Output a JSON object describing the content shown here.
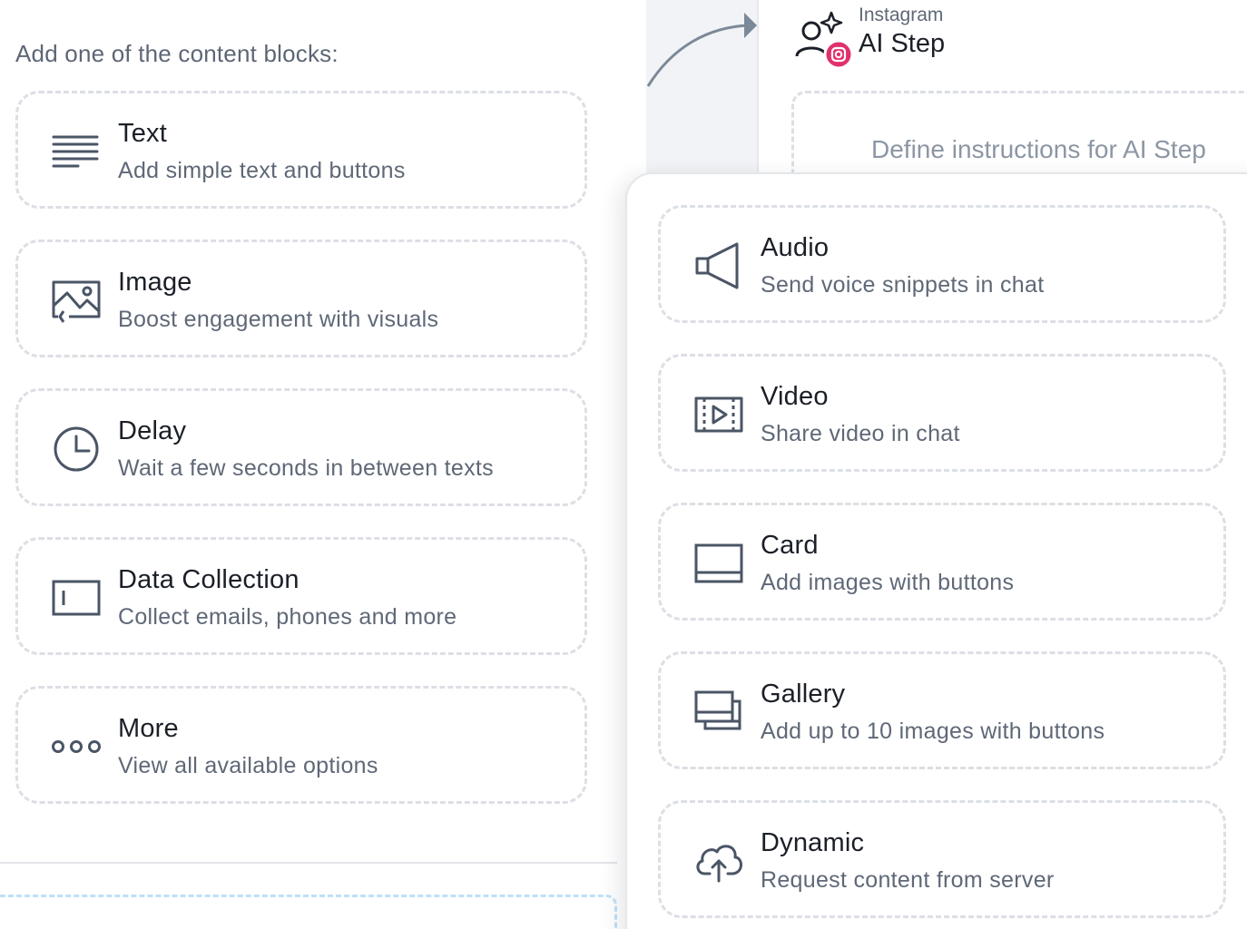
{
  "left_panel": {
    "prompt": "Add one of the content blocks:",
    "blocks": [
      {
        "title": "Text",
        "desc": "Add simple text and buttons",
        "icon": "text-lines-icon"
      },
      {
        "title": "Image",
        "desc": "Boost engagement with visuals",
        "icon": "image-icon"
      },
      {
        "title": "Delay",
        "desc": "Wait a few seconds in between texts",
        "icon": "clock-icon"
      },
      {
        "title": "Data Collection",
        "desc": "Collect emails, phones and more",
        "icon": "input-field-icon"
      },
      {
        "title": "More",
        "desc": "View all available options",
        "icon": "more-dots-icon"
      }
    ]
  },
  "node": {
    "subtitle": "Instagram",
    "title": "AI Step",
    "instructions_placeholder": "Define instructions for AI Step",
    "icon": "ai-person-sparkle-icon",
    "badge_icon": "instagram-icon",
    "badge_color": "#e1306c"
  },
  "more_menu": {
    "blocks": [
      {
        "title": "Audio",
        "desc": "Send voice snippets in chat",
        "icon": "speaker-icon"
      },
      {
        "title": "Video",
        "desc": "Share video in chat",
        "icon": "video-film-icon"
      },
      {
        "title": "Card",
        "desc": "Add images with buttons",
        "icon": "card-icon"
      },
      {
        "title": "Gallery",
        "desc": "Add up to 10 images with buttons",
        "icon": "gallery-icon"
      },
      {
        "title": "Dynamic",
        "desc": "Request content from server",
        "icon": "cloud-upload-icon"
      }
    ]
  },
  "colors": {
    "icon_stroke": "#4a5566",
    "accent_connector": "#7b8898",
    "dashed_border": "#dcdfe4"
  }
}
